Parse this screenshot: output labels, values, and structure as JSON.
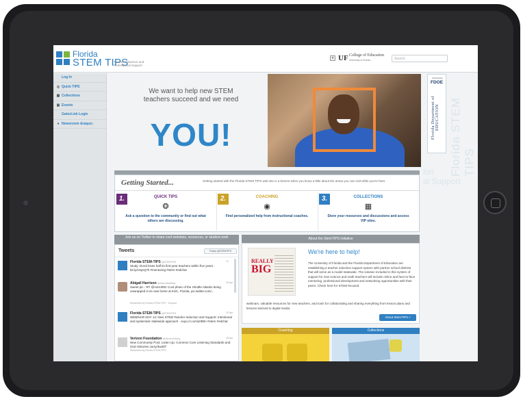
{
  "header": {
    "logo_line1": "Florida",
    "logo_line2": "STEM TIPS",
    "logo_tagline": "Teacher Induction and Professional Support",
    "uf_mark": "UF",
    "uf_college": "College of Education",
    "uf_university": "University of Florida",
    "search_placeholder": "Search"
  },
  "sidebar": {
    "items": [
      {
        "label": "Log In",
        "icon": ""
      },
      {
        "label": "Quick TIPS",
        "icon": "question-icon"
      },
      {
        "label": "Collections",
        "icon": "grid-icon"
      },
      {
        "label": "Events",
        "icon": "calendar-icon"
      },
      {
        "label": "GatorLink Login",
        "icon": ""
      },
      {
        "label": "Newsroom &raquo;",
        "icon": "info-icon"
      }
    ]
  },
  "hero": {
    "line1": "We want to help new STEM teachers succeed and we need",
    "you": "YOU!"
  },
  "fdoe": {
    "small": "Partnership",
    "title": "FDOE",
    "vertical": "Florida Department of EDUCATION"
  },
  "watermark": {
    "vertical": "Florida STEM TIPS",
    "side": "ion",
    "side2": "al Support"
  },
  "getting_started": {
    "title": "Getting Started...",
    "intro": "Getting started with the Florida STEM TIPS web site is a breeze when you know a little about the areas you can visit while you're here.",
    "columns": [
      {
        "num": "1.",
        "title": "QUICK TIPS",
        "icon": "lightbulb-icon",
        "text": "Ask a question to the community or find out what others are discussing.",
        "color": "#6b2c7a"
      },
      {
        "num": "2.",
        "title": "COACHING",
        "icon": "eye-icon",
        "text": "Find personalized help from instructional coaches.",
        "color": "#c9a227"
      },
      {
        "num": "3.",
        "title": "COLLECTIONS",
        "icon": "grid-icon",
        "text": "Store your resources and discussions and access VIP sites.",
        "color": "#2f7fc1"
      }
    ]
  },
  "twitter": {
    "header": "Join us on Twitter to share cool websites, resources, or student work",
    "title": "Tweets",
    "follow_label": "Follow @STEMTIPS",
    "tweets": [
      {
        "name": "Florida STEM-TIPS",
        "handle": "@STEMTIPS",
        "time": "7h",
        "body": "Study: Dural loses half its first-year teachers within five years · bit.ly/1SprQ7k #mentoring #stem #edchat",
        "meta": ""
      },
      {
        "name": "Abigail Harrison",
        "handle": "@AstronautAbby",
        "time": "29 Apr",
        "body": "Sweet pic - RT @AstroRM: Cool photo of the Shuttle Atlantis being unwrapped in its new home at KSC, Florida. pic.twitter.com/...",
        "meta": "Retweeted by Florida STEM-TIPS · Expand"
      },
      {
        "name": "Florida STEM-TIPS",
        "handle": "@STEMTIPS",
        "time": "22 Apr",
        "body": "WEBINAR MAY 14: New STEM Teacher Induction and Support: Intentional and systematic statewide approach · ecpu.rt.com/y0B0n #stem #edchat",
        "meta": ""
      },
      {
        "name": "Verizon Foundation",
        "handle": "@VerizonGiving",
        "time": "18 Apr",
        "body": "New Community Post: Listen Up: Common Core Listening Standards and Oral Histories ow.ly/3wd3T",
        "meta": "Retweeted by Florida STEM-TIPS"
      }
    ]
  },
  "about": {
    "header": "About the StemTIPS Initiative",
    "thumb_line1": "REALLY",
    "thumb_line2": "BIG",
    "heading": "We're here to help!",
    "text": "The University of Florida and the Florida Department of Education are establishing a teacher induction support system with partner school districts that will serve as a model statewide. The solution included in this system of support for new science and math teachers will include online and face-to-face mentoring, professional development and networking opportunities with their peers. Check here for STEM-focused",
    "text_wide": "webinars, valuable resources for new teachers, and tools for collaborating and sharing everything from lesson plans and lessons learned to digital media.",
    "button": "About StemTIPS »"
  },
  "tiles": [
    {
      "label": "Coaching",
      "color": "#c9a227"
    },
    {
      "label": "Collections",
      "color": "#2f7fc1"
    }
  ]
}
